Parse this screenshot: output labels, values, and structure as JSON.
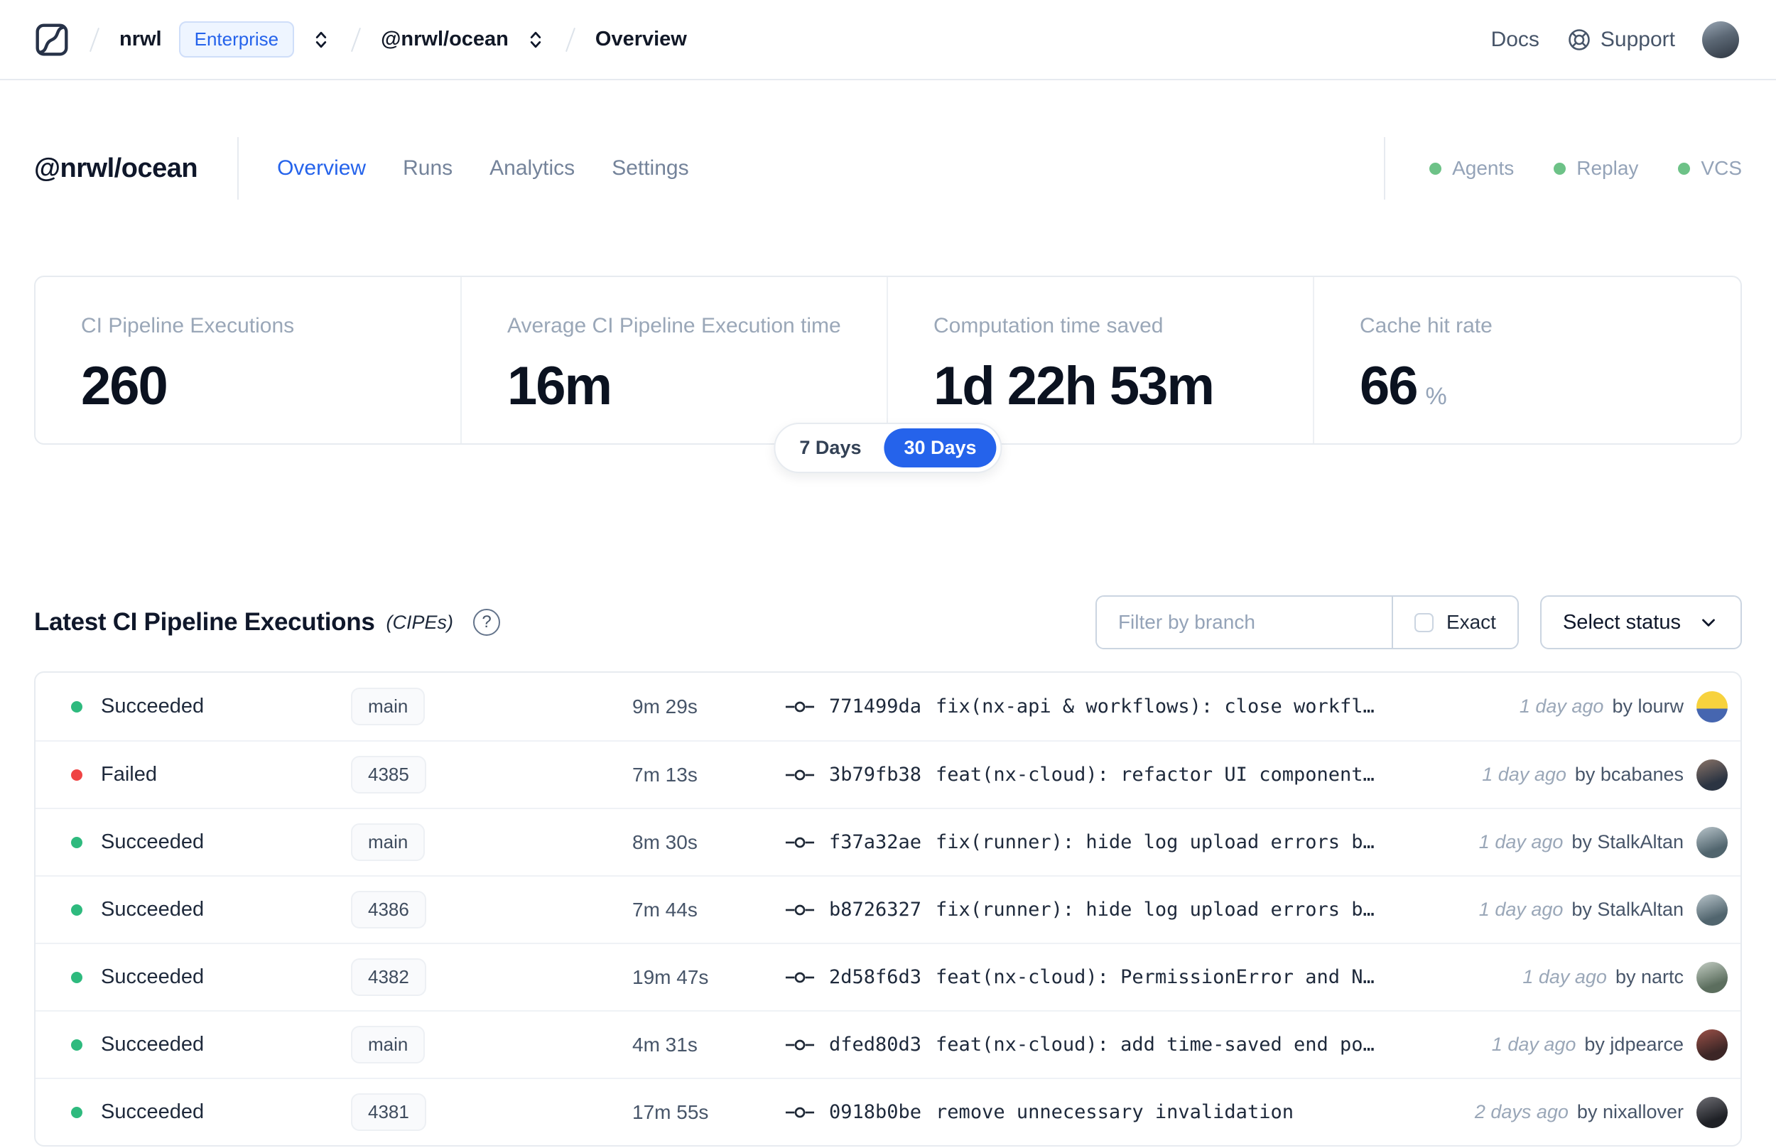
{
  "colors": {
    "accent_blue": "#2563eb",
    "success_green": "#2eba7e",
    "failed_red": "#ef4444",
    "indicator_green": "#6dc287"
  },
  "icons": {
    "logo": "nx-cloud-logo",
    "selector": "chevron-up-down-icon",
    "support": "life-ring-icon",
    "help": "question-circle-icon",
    "help_glyph": "?",
    "commit": "git-commit-icon",
    "dropdown": "chevron-down-icon"
  },
  "header": {
    "breadcrumb": {
      "org": "nrwl",
      "org_badge": "Enterprise",
      "workspace": "@nrwl/ocean",
      "page": "Overview"
    },
    "docs_label": "Docs",
    "support_label": "Support"
  },
  "workspace": {
    "title": "@nrwl/ocean",
    "tabs": [
      {
        "label": "Overview",
        "active": true
      },
      {
        "label": "Runs",
        "active": false
      },
      {
        "label": "Analytics",
        "active": false
      },
      {
        "label": "Settings",
        "active": false
      }
    ],
    "indicators": [
      {
        "label": "Agents"
      },
      {
        "label": "Replay"
      },
      {
        "label": "VCS"
      }
    ]
  },
  "stats": {
    "cards": [
      {
        "label": "CI Pipeline Executions",
        "value": "260"
      },
      {
        "label": "Average CI Pipeline Execution time",
        "value": "16m"
      },
      {
        "label": "Computation time saved",
        "value": "1d 22h 53m"
      },
      {
        "label": "Cache hit rate",
        "value": "66",
        "suffix": "%"
      }
    ],
    "range_toggle": {
      "options": [
        "7 Days",
        "30 Days"
      ],
      "selected": "30 Days"
    }
  },
  "cipe_section": {
    "title": "Latest CI Pipeline Executions",
    "title_suffix": "(CIPEs)",
    "filter_placeholder": "Filter by branch",
    "exact_label": "Exact",
    "status_button": "Select status",
    "rows": [
      {
        "status": "Succeeded",
        "status_color": "green",
        "branch": "main",
        "duration": "9m 29s",
        "commit": "771499da",
        "message": "fix(nx-api & workflows): close workfl…",
        "time": "1 day ago",
        "author": "by lourw"
      },
      {
        "status": "Failed",
        "status_color": "red",
        "branch": "4385",
        "duration": "7m 13s",
        "commit": "3b79fb38",
        "message": "feat(nx-cloud): refactor UI component…",
        "time": "1 day ago",
        "author": "by bcabanes"
      },
      {
        "status": "Succeeded",
        "status_color": "green",
        "branch": "main",
        "duration": "8m 30s",
        "commit": "f37a32ae",
        "message": "fix(runner): hide log upload errors b…",
        "time": "1 day ago",
        "author": "by StalkAltan"
      },
      {
        "status": "Succeeded",
        "status_color": "green",
        "branch": "4386",
        "duration": "7m 44s",
        "commit": "b8726327",
        "message": "fix(runner): hide log upload errors b…",
        "time": "1 day ago",
        "author": "by StalkAltan"
      },
      {
        "status": "Succeeded",
        "status_color": "green",
        "branch": "4382",
        "duration": "19m 47s",
        "commit": "2d58f6d3",
        "message": "feat(nx-cloud): PermissionError and N…",
        "time": "1 day ago",
        "author": "by nartc"
      },
      {
        "status": "Succeeded",
        "status_color": "green",
        "branch": "main",
        "duration": "4m 31s",
        "commit": "dfed80d3",
        "message": "feat(nx-cloud): add time-saved end po…",
        "time": "1 day ago",
        "author": "by jdpearce"
      },
      {
        "status": "Succeeded",
        "status_color": "green",
        "branch": "4381",
        "duration": "17m 55s",
        "commit": "0918b0be",
        "message": "remove unnecessary invalidation",
        "time": "2 days ago",
        "author": "by nixallover"
      }
    ]
  }
}
